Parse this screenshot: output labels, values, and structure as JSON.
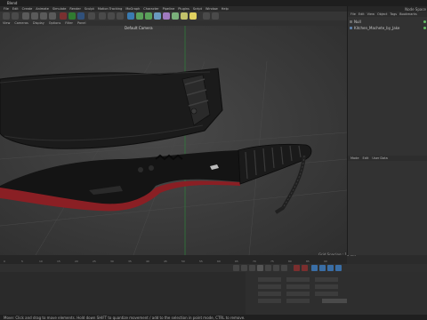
{
  "titlebar": {
    "title": "Blend"
  },
  "menubar": {
    "items": [
      "File",
      "Edit",
      "Create",
      "Animate",
      "Simulate",
      "Render",
      "Sculpt",
      "Motion Tracking",
      "MoGraph",
      "Character",
      "Pipeline",
      "Plugins",
      "Script",
      "Window",
      "Help"
    ]
  },
  "viewport": {
    "menu": [
      "View",
      "Cameras",
      "Display",
      "Options",
      "Filter",
      "Panel"
    ],
    "camera_label": "Default Camera",
    "grid_info": "Grid Spacing : 10 cm"
  },
  "right_panel": {
    "layout_label": "Node Space",
    "menu": [
      "File",
      "Edit",
      "View",
      "Object",
      "Tags",
      "Bookmarks"
    ],
    "objects": [
      {
        "name": "Null",
        "color": "#d8d8d8"
      },
      {
        "name": "Kitchen_Machete_by_Jake",
        "color": "#d8d8d8"
      }
    ],
    "attr_menu": [
      "Mode",
      "Edit",
      "User Data"
    ]
  },
  "timeline": {
    "ticks": [
      "0",
      "5",
      "10",
      "15",
      "20",
      "25",
      "30",
      "35",
      "40",
      "45",
      "50",
      "55",
      "60",
      "65",
      "70",
      "75",
      "80",
      "85",
      "90"
    ]
  },
  "status": {
    "text": "Move: Click and drag to move elements. Hold down SHIFT to quantize movement / add to the selection in point mode, CTRL to remove."
  },
  "colors": {
    "blade_red": "#8a1f24",
    "accent_blue": "#3a6ea5"
  }
}
